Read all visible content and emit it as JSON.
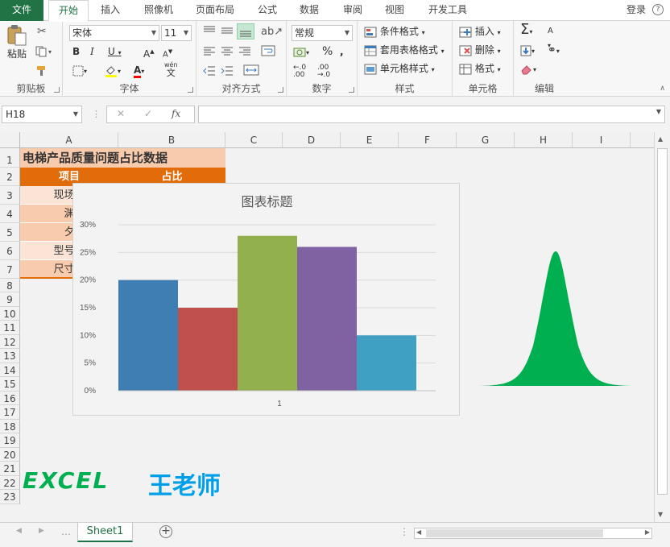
{
  "ribbon_tabs": [
    "文件",
    "开始",
    "插入",
    "照像机",
    "页面布局",
    "公式",
    "数据",
    "审阅",
    "视图",
    "开发工具"
  ],
  "active_tab": "开始",
  "login": "登录",
  "clipboard": {
    "paste": "粘贴",
    "label": "剪贴板"
  },
  "font": {
    "family": "宋体",
    "size": "11",
    "label": "字体",
    "wen": "wén",
    "wen_char": "文"
  },
  "alignment": {
    "label": "对齐方式"
  },
  "number": {
    "format": "常规",
    "label": "数字",
    "percent": "%"
  },
  "styles": {
    "conditional": "条件格式",
    "table": "套用表格格式",
    "cell": "单元格样式",
    "label": "样式"
  },
  "cells": {
    "insert": "插入",
    "delete": "删除",
    "format": "格式",
    "label": "单元格"
  },
  "editing": {
    "label": "编辑"
  },
  "formula_bar": {
    "name_box": "H18",
    "fx": "fx",
    "formula": ""
  },
  "columns": [
    "A",
    "B",
    "C",
    "D",
    "E",
    "F",
    "G",
    "H",
    "I"
  ],
  "rows": [
    "1",
    "2",
    "3",
    "4",
    "5",
    "6",
    "7",
    "8",
    "9",
    "10",
    "11",
    "12",
    "13",
    "14",
    "15",
    "16",
    "17",
    "18",
    "19",
    "20",
    "21",
    "22",
    "23"
  ],
  "cells_data": {
    "a1": "电梯产品质量问题占比数据",
    "a2": "项目",
    "b2": "占比",
    "a3": "现场护",
    "a4": "渊",
    "a5": "夕",
    "a6": "型号錯",
    "a7": "尺寸錯"
  },
  "watermark": {
    "excel": "EXCEL",
    "name": "王老师"
  },
  "sheet_tab": "Sheet1",
  "chart_data": {
    "type": "bar",
    "title": "图表标题",
    "categories": [
      "1"
    ],
    "yticks": [
      "0%",
      "5%",
      "10%",
      "15%",
      "20%",
      "25%",
      "30%"
    ],
    "ylim": [
      0,
      0.3
    ],
    "grid": true,
    "series": [
      {
        "values": [
          0.2
        ],
        "color": "#3f7eb3"
      },
      {
        "values": [
          0.15
        ],
        "color": "#c0504d"
      },
      {
        "values": [
          0.28
        ],
        "color": "#93b04e"
      },
      {
        "values": [
          0.26
        ],
        "color": "#8061a2"
      },
      {
        "values": [
          0.1
        ],
        "color": "#3fa0c3"
      }
    ]
  },
  "colors": {
    "excel_green": "#217346",
    "header_orange": "#e26b0a",
    "title_fill": "#f8cbad",
    "bell_green": "#00b050",
    "watermark_green": "#00b050",
    "watermark_blue": "#00a0e9"
  }
}
